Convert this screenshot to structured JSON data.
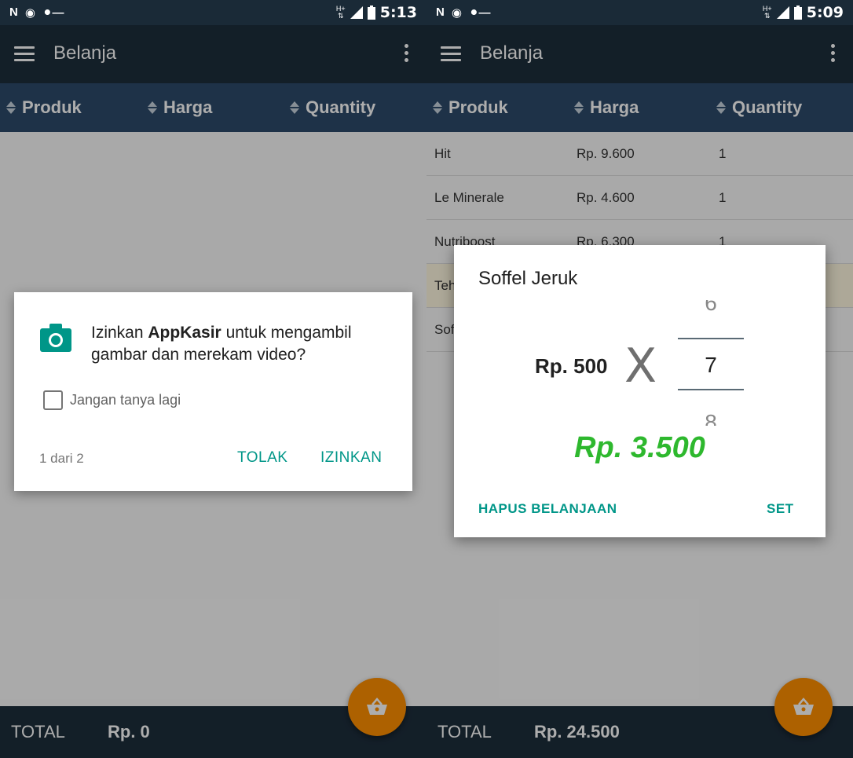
{
  "left": {
    "status": {
      "time": "5:13",
      "left_icons": [
        "N",
        "lock",
        "key"
      ]
    },
    "appbar": {
      "title": "Belanja"
    },
    "table": {
      "headers": [
        "Produk",
        "Harga",
        "Quantity"
      ]
    },
    "footer": {
      "total_label": "TOTAL",
      "total_value": "Rp. 0"
    },
    "dialog": {
      "prefix": "Izinkan ",
      "app_name": "AppKasir",
      "suffix": " untuk mengambil gambar dan merekam video?",
      "checkbox_label": "Jangan tanya lagi",
      "page": "1 dari 2",
      "deny": "TOLAK",
      "allow": "IZINKAN"
    }
  },
  "right": {
    "status": {
      "time": "5:09",
      "left_icons": [
        "N",
        "lock",
        "key"
      ]
    },
    "appbar": {
      "title": "Belanja"
    },
    "table": {
      "headers": [
        "Produk",
        "Harga",
        "Quantity"
      ],
      "rows": [
        {
          "produk": "Hit",
          "harga": "Rp. 9.600",
          "qty": "1"
        },
        {
          "produk": "Le Minerale",
          "harga": "Rp. 4.600",
          "qty": "1"
        },
        {
          "produk": "Nutriboost",
          "harga": "Rp. 6.300",
          "qty": "1"
        },
        {
          "produk": "Teh",
          "harga": "",
          "qty": ""
        },
        {
          "produk": "Sof",
          "harga": "",
          "qty": ""
        }
      ]
    },
    "footer": {
      "total_label": "TOTAL",
      "total_value": "Rp. 24.500"
    },
    "dialog": {
      "title": "Soffel Jeruk",
      "unit_price": "Rp. 500",
      "times": "X",
      "picker_prev": "6",
      "picker_current": "7",
      "picker_next": "8",
      "subtotal": "Rp. 3.500",
      "delete_button": "HAPUS BELANJAAN",
      "set_button": "SET"
    }
  },
  "colors": {
    "appbar": "#1d2e3c",
    "table_header": "#2d4a6a",
    "accent": "#009688",
    "fab": "#ff8f00",
    "subtotal": "#2eb82e"
  }
}
